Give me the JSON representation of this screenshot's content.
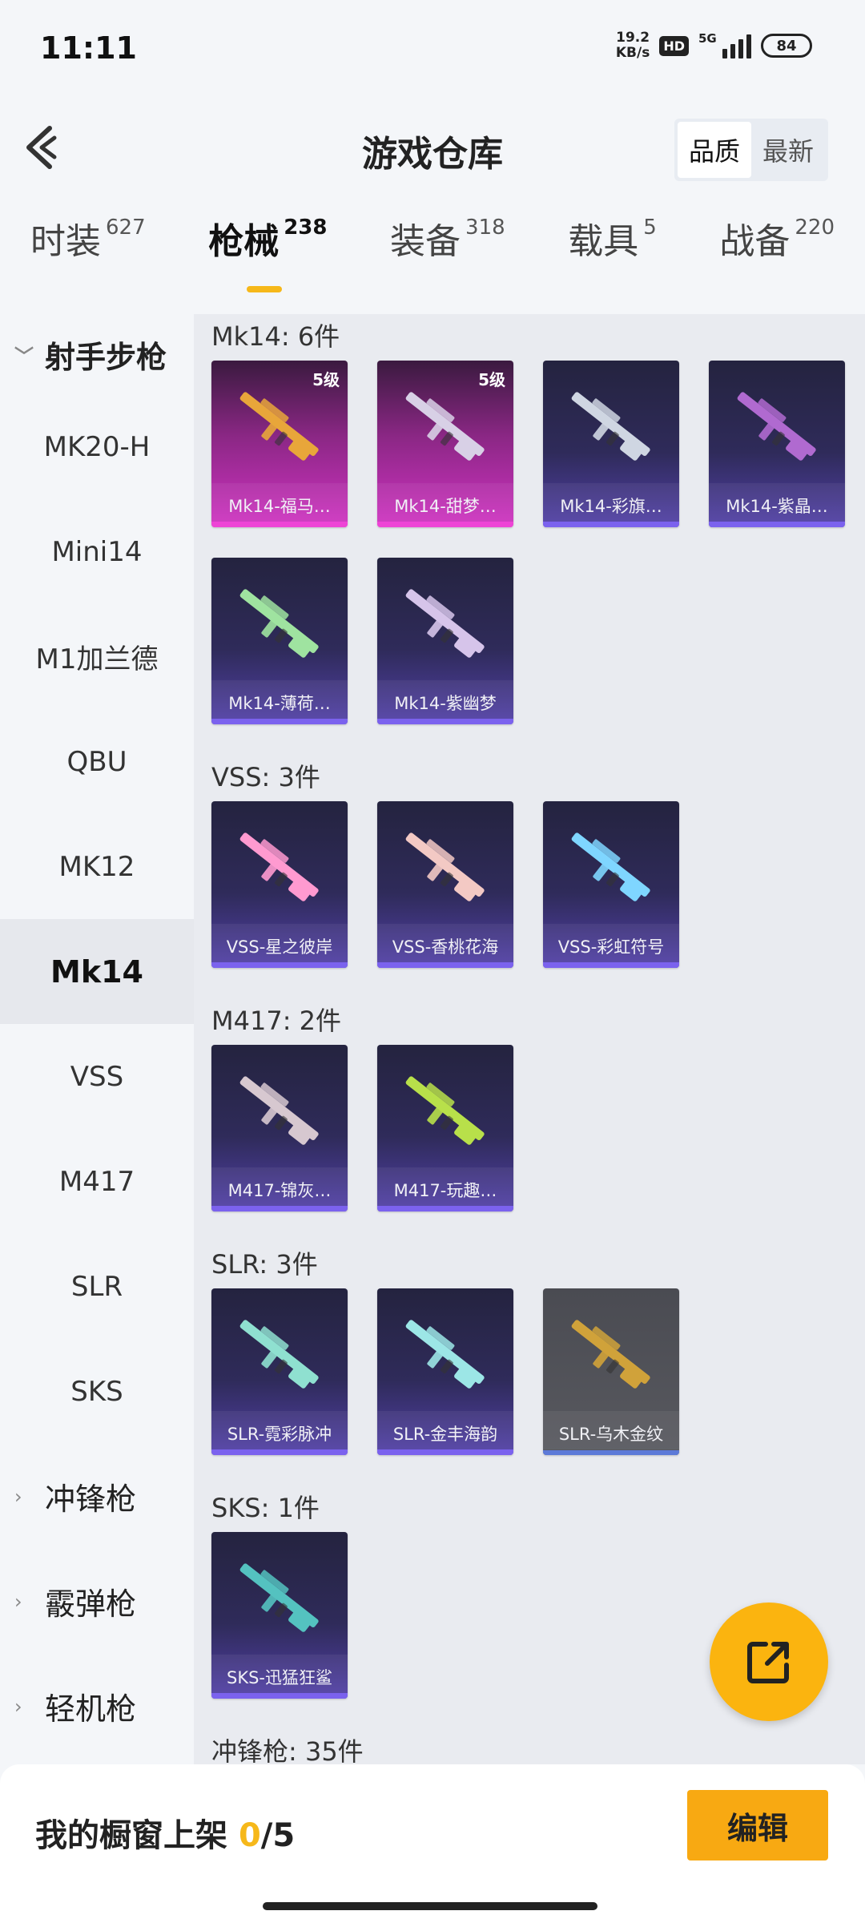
{
  "status": {
    "time": "11:11",
    "speed_value": "19.2",
    "speed_unit": "KB/s",
    "hd": "HD",
    "network": "5G",
    "battery": "84"
  },
  "header": {
    "title": "游戏仓库",
    "sort_quality": "品质",
    "sort_latest": "最新"
  },
  "tabs": [
    {
      "label": "时装",
      "count": "627"
    },
    {
      "label": "枪械",
      "count": "238"
    },
    {
      "label": "装备",
      "count": "318"
    },
    {
      "label": "载具",
      "count": "5"
    },
    {
      "label": "战备",
      "count": "220"
    }
  ],
  "sidebar": {
    "group_open": "射手步枪",
    "items": [
      "MK20-H",
      "Mini14",
      "M1加兰德",
      "QBU",
      "MK12",
      "Mk14",
      "VSS",
      "M417",
      "SLR",
      "SKS"
    ],
    "groups_collapsed": [
      "冲锋枪",
      "霰弹枪",
      "轻机枪"
    ]
  },
  "sections": [
    {
      "title": "Mk14: 6件",
      "items": [
        {
          "name": "Mk14-福马…",
          "level": "5级",
          "style": "pink"
        },
        {
          "name": "Mk14-甜梦…",
          "level": "5级",
          "style": "pink"
        },
        {
          "name": "Mk14-彩旗…",
          "level": "",
          "style": "purple"
        },
        {
          "name": "Mk14-紫晶…",
          "level": "",
          "style": "purple"
        },
        {
          "name": "Mk14-薄荷…",
          "level": "",
          "style": "purple"
        },
        {
          "name": "Mk14-紫幽梦",
          "level": "",
          "style": "purple"
        }
      ]
    },
    {
      "title": "VSS: 3件",
      "items": [
        {
          "name": "VSS-星之彼岸",
          "level": "",
          "style": "purple"
        },
        {
          "name": "VSS-香桃花海",
          "level": "",
          "style": "purple"
        },
        {
          "name": "VSS-彩虹符号",
          "level": "",
          "style": "purple"
        }
      ]
    },
    {
      "title": "M417: 2件",
      "items": [
        {
          "name": "M417-锦灰…",
          "level": "",
          "style": "purple"
        },
        {
          "name": "M417-玩趣…",
          "level": "",
          "style": "purple"
        }
      ]
    },
    {
      "title": "SLR: 3件",
      "items": [
        {
          "name": "SLR-霓彩脉冲",
          "level": "",
          "style": "purple"
        },
        {
          "name": "SLR-金丰海韵",
          "level": "",
          "style": "purple"
        },
        {
          "name": "SLR-乌木金纹",
          "level": "",
          "style": "grey"
        }
      ]
    },
    {
      "title": "SKS: 1件",
      "items": [
        {
          "name": "SKS-迅猛狂鲨",
          "level": "",
          "style": "purple"
        }
      ]
    },
    {
      "title": "冲锋枪: 35件",
      "items": []
    }
  ],
  "bottom": {
    "showcase_label": "我的橱窗上架",
    "showcase_used": "0",
    "showcase_total": "/5",
    "edit_label": "编辑"
  },
  "colors": {
    "accent": "#f6b81a",
    "edit_button": "#f8a912",
    "card_purple": "#5240a8",
    "card_pink": "#d033c2"
  }
}
